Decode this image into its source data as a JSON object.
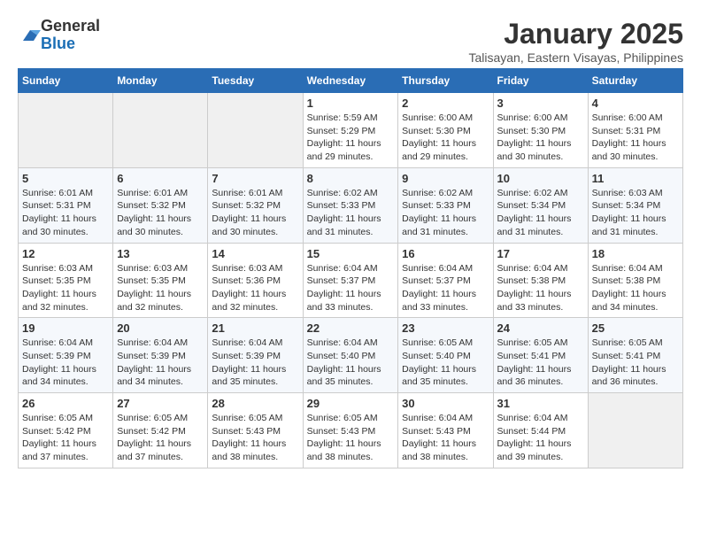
{
  "logo": {
    "general": "General",
    "blue": "Blue"
  },
  "header": {
    "title": "January 2025",
    "subtitle": "Talisayan, Eastern Visayas, Philippines"
  },
  "weekdays": [
    "Sunday",
    "Monday",
    "Tuesday",
    "Wednesday",
    "Thursday",
    "Friday",
    "Saturday"
  ],
  "weeks": [
    [
      {
        "day": "",
        "info": ""
      },
      {
        "day": "",
        "info": ""
      },
      {
        "day": "",
        "info": ""
      },
      {
        "day": "1",
        "info": "Sunrise: 5:59 AM\nSunset: 5:29 PM\nDaylight: 11 hours and 29 minutes."
      },
      {
        "day": "2",
        "info": "Sunrise: 6:00 AM\nSunset: 5:30 PM\nDaylight: 11 hours and 29 minutes."
      },
      {
        "day": "3",
        "info": "Sunrise: 6:00 AM\nSunset: 5:30 PM\nDaylight: 11 hours and 30 minutes."
      },
      {
        "day": "4",
        "info": "Sunrise: 6:00 AM\nSunset: 5:31 PM\nDaylight: 11 hours and 30 minutes."
      }
    ],
    [
      {
        "day": "5",
        "info": "Sunrise: 6:01 AM\nSunset: 5:31 PM\nDaylight: 11 hours and 30 minutes."
      },
      {
        "day": "6",
        "info": "Sunrise: 6:01 AM\nSunset: 5:32 PM\nDaylight: 11 hours and 30 minutes."
      },
      {
        "day": "7",
        "info": "Sunrise: 6:01 AM\nSunset: 5:32 PM\nDaylight: 11 hours and 30 minutes."
      },
      {
        "day": "8",
        "info": "Sunrise: 6:02 AM\nSunset: 5:33 PM\nDaylight: 11 hours and 31 minutes."
      },
      {
        "day": "9",
        "info": "Sunrise: 6:02 AM\nSunset: 5:33 PM\nDaylight: 11 hours and 31 minutes."
      },
      {
        "day": "10",
        "info": "Sunrise: 6:02 AM\nSunset: 5:34 PM\nDaylight: 11 hours and 31 minutes."
      },
      {
        "day": "11",
        "info": "Sunrise: 6:03 AM\nSunset: 5:34 PM\nDaylight: 11 hours and 31 minutes."
      }
    ],
    [
      {
        "day": "12",
        "info": "Sunrise: 6:03 AM\nSunset: 5:35 PM\nDaylight: 11 hours and 32 minutes."
      },
      {
        "day": "13",
        "info": "Sunrise: 6:03 AM\nSunset: 5:35 PM\nDaylight: 11 hours and 32 minutes."
      },
      {
        "day": "14",
        "info": "Sunrise: 6:03 AM\nSunset: 5:36 PM\nDaylight: 11 hours and 32 minutes."
      },
      {
        "day": "15",
        "info": "Sunrise: 6:04 AM\nSunset: 5:37 PM\nDaylight: 11 hours and 33 minutes."
      },
      {
        "day": "16",
        "info": "Sunrise: 6:04 AM\nSunset: 5:37 PM\nDaylight: 11 hours and 33 minutes."
      },
      {
        "day": "17",
        "info": "Sunrise: 6:04 AM\nSunset: 5:38 PM\nDaylight: 11 hours and 33 minutes."
      },
      {
        "day": "18",
        "info": "Sunrise: 6:04 AM\nSunset: 5:38 PM\nDaylight: 11 hours and 34 minutes."
      }
    ],
    [
      {
        "day": "19",
        "info": "Sunrise: 6:04 AM\nSunset: 5:39 PM\nDaylight: 11 hours and 34 minutes."
      },
      {
        "day": "20",
        "info": "Sunrise: 6:04 AM\nSunset: 5:39 PM\nDaylight: 11 hours and 34 minutes."
      },
      {
        "day": "21",
        "info": "Sunrise: 6:04 AM\nSunset: 5:39 PM\nDaylight: 11 hours and 35 minutes."
      },
      {
        "day": "22",
        "info": "Sunrise: 6:04 AM\nSunset: 5:40 PM\nDaylight: 11 hours and 35 minutes."
      },
      {
        "day": "23",
        "info": "Sunrise: 6:05 AM\nSunset: 5:40 PM\nDaylight: 11 hours and 35 minutes."
      },
      {
        "day": "24",
        "info": "Sunrise: 6:05 AM\nSunset: 5:41 PM\nDaylight: 11 hours and 36 minutes."
      },
      {
        "day": "25",
        "info": "Sunrise: 6:05 AM\nSunset: 5:41 PM\nDaylight: 11 hours and 36 minutes."
      }
    ],
    [
      {
        "day": "26",
        "info": "Sunrise: 6:05 AM\nSunset: 5:42 PM\nDaylight: 11 hours and 37 minutes."
      },
      {
        "day": "27",
        "info": "Sunrise: 6:05 AM\nSunset: 5:42 PM\nDaylight: 11 hours and 37 minutes."
      },
      {
        "day": "28",
        "info": "Sunrise: 6:05 AM\nSunset: 5:43 PM\nDaylight: 11 hours and 38 minutes."
      },
      {
        "day": "29",
        "info": "Sunrise: 6:05 AM\nSunset: 5:43 PM\nDaylight: 11 hours and 38 minutes."
      },
      {
        "day": "30",
        "info": "Sunrise: 6:04 AM\nSunset: 5:43 PM\nDaylight: 11 hours and 38 minutes."
      },
      {
        "day": "31",
        "info": "Sunrise: 6:04 AM\nSunset: 5:44 PM\nDaylight: 11 hours and 39 minutes."
      },
      {
        "day": "",
        "info": ""
      }
    ]
  ]
}
